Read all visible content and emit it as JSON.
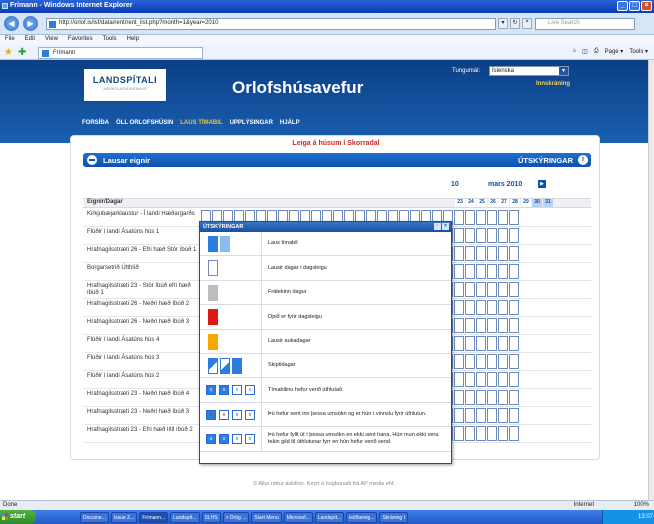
{
  "window": {
    "title": "Frímann - Windows Internet Explorer"
  },
  "address": {
    "url": "http://orlof.is/lsf/data/rent/rent_list.php?month=1&year=2010",
    "search_placeholder": "Live Search"
  },
  "menu": [
    "File",
    "Edit",
    "View",
    "Favorites",
    "Tools",
    "Help"
  ],
  "tab": {
    "label": "Frímann"
  },
  "tooltip": {
    "line1": "Frímann",
    "line2": "http://orlof.is/lsf/data/rent/rent_list.php?month=1&year=2010"
  },
  "tab_tools": [
    "Page ▾",
    "Tools ▾"
  ],
  "header": {
    "logo_main": "LANDSPÍTALI",
    "logo_sub": "HÁSKÓLASJÚKRAHÚS",
    "site_title": "Orlofshúsavefur",
    "lang_label": "Tungumál:",
    "lang_value": "Íslenska",
    "login": "Innskráning"
  },
  "nav": [
    "FORSÍÐA",
    "ÖLL ORLOFSHÚSIN",
    "LAUS TÍMABIL",
    "UPPLÝSINGAR",
    "HJÁLP"
  ],
  "notice": "Leiga á húsum í Skorradal",
  "bar": {
    "left": "Lausar eignir",
    "right": "ÚTSKÝRINGAR"
  },
  "calendar": {
    "month_prev": "10",
    "month_current": "mars 2010",
    "column_header": "Eignir/Dagar",
    "days": [
      "23",
      "24",
      "25",
      "26",
      "27",
      "28",
      "29",
      "30",
      "31"
    ]
  },
  "rows": [
    "Kirkjubæjarklaustur - Í landi Hæðargarðs",
    "Flúðir í landi Ásatúns hús 1",
    "Hrafnagilsstræti 26 - Efri hæð Stór íbúð 1",
    "Borgarsetrið Útthlíð",
    "Hrafnagilsstræti 23 - Stór íbúð efri hæð íbúð 1",
    "Hrafnagilsstræti 26 - Neðri hæð íbúð 2",
    "Hrafnagilsstræti 26 - Neðri hæð íbúð 3",
    "Flúðir í landi Ásatúns hús 4",
    "Flúðir í landi Ásatúns hús 3",
    "Flúðir í landi Ásatúns hús 2",
    "Hrafnagilsstræti 23 - Neðri hæð íbúð 4",
    "Hrafnagilsstræti 23 - Neðri hæð íbúð 3",
    "Hrafnagilsstræti 23 - Efri hæð lítil íbúð 2"
  ],
  "popup": {
    "title": "ÚTSKÝRINGAR",
    "legend": [
      "Laus tímabil",
      "Lausir dagar í dagsleigu",
      "Frátekinn dagur",
      "Opið er fyrir dagsleigu",
      "Lausir aukadagar",
      "Skiptidagar",
      "Tímabilinu hefur verið úthlutað.",
      "Þú hefur sent inn þessa umsókn og er hún í vinnslu fyrir úthlutun.",
      "Þú hefur fyllt út í þessa umsókn en ekki sent hana. Hún mun ekki vera tekin gild til úthlutunar fyrr en hún hefur verið send."
    ]
  },
  "footer": "© Allur réttur áskilinn. Keyrt á hugbúnaði frá AP media ehf.",
  "status": {
    "left": "Done",
    "zone": "Internet",
    "zoom": "100%"
  },
  "taskbar": {
    "start": "start",
    "tasks": [
      "Docume...",
      "Issue Z...",
      "Frímann...",
      "Landspít...",
      "SLHS",
      "> Drög ...",
      "Start Menu",
      "Microsof...",
      "Landspít...",
      "leiðbeinig...",
      "Skráning I"
    ],
    "clock": "13:07"
  },
  "colors": {
    "accent": "#0d52ae",
    "notice": "#c92a2a",
    "header_bg": "#0b3f86"
  }
}
